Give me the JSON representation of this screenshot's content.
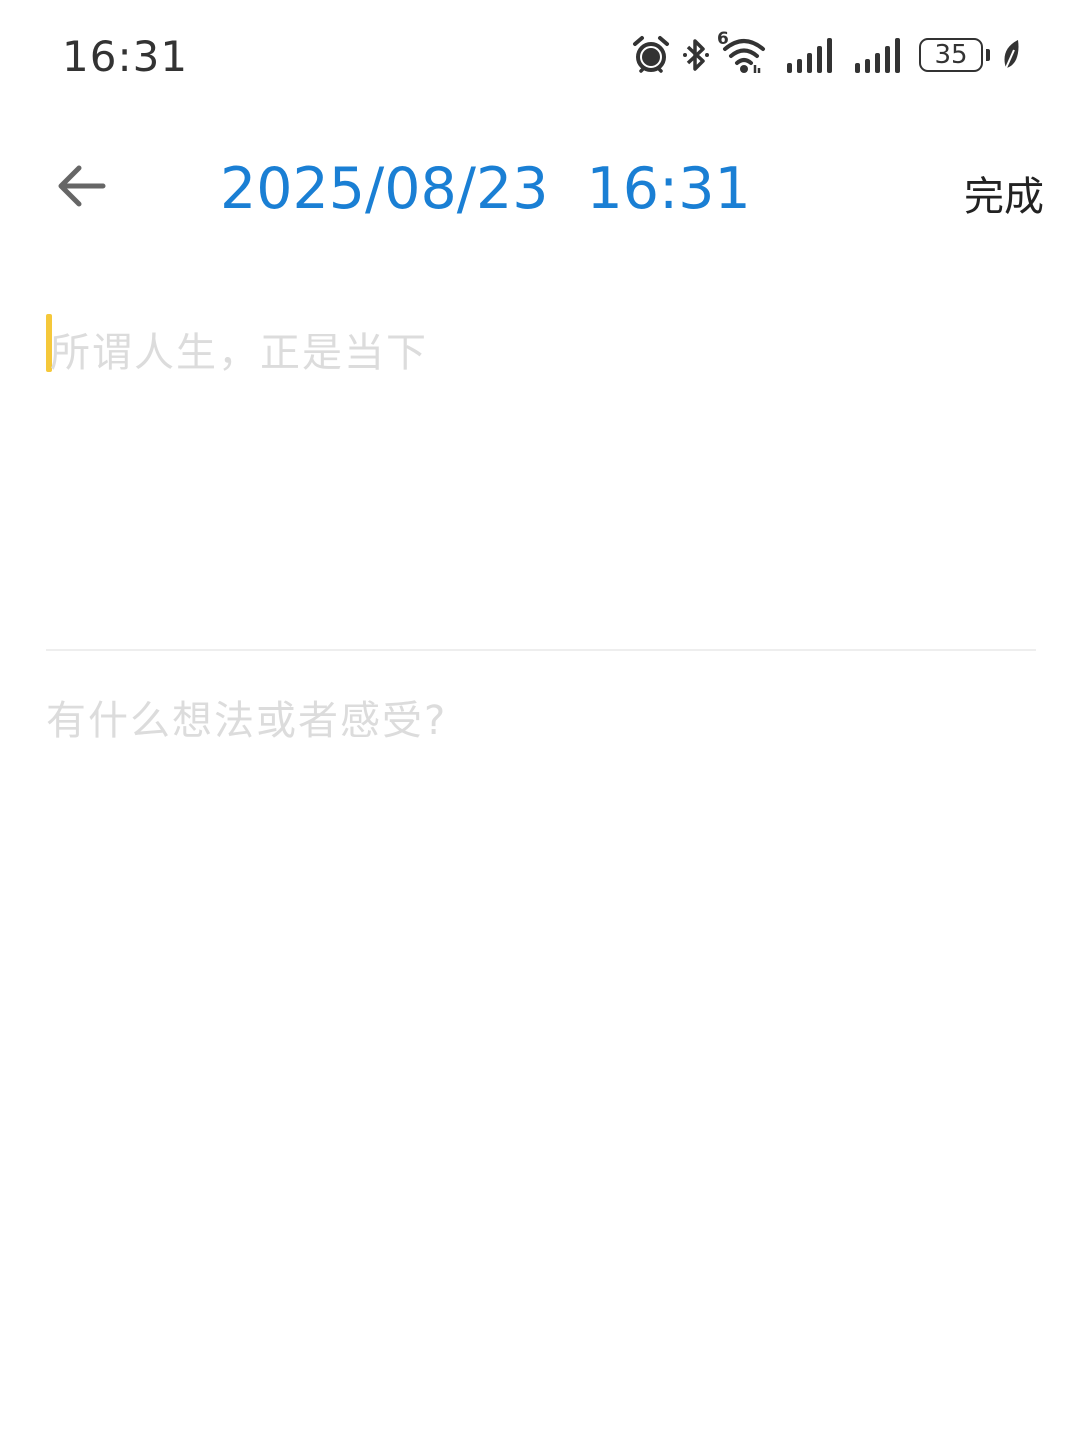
{
  "status_bar": {
    "time": "16:31",
    "battery_level": "35",
    "network_label": "6",
    "icons": [
      "alarm-icon",
      "bluetooth-icon",
      "wifi-icon",
      "signal-icon",
      "signal-icon",
      "battery-icon",
      "leaf-icon"
    ]
  },
  "header": {
    "date": "2025/08/23",
    "time": "16:31",
    "done_label": "完成",
    "back_icon": "arrow-left-icon"
  },
  "editor": {
    "title_placeholder": "所谓人生，正是当下",
    "content_placeholder": "有什么想法或者感受?"
  },
  "colors": {
    "accent": "#1a7fd4",
    "cursor": "#f5c83a",
    "placeholder": "#dcdcdc",
    "divider": "#eeeeee"
  }
}
